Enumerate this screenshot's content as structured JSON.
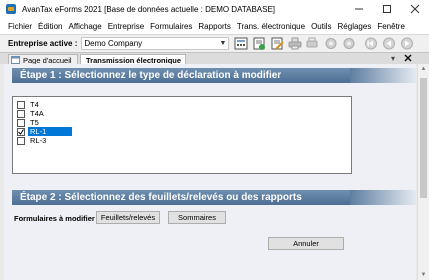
{
  "window": {
    "title": "AvanTax eForms 2021 [Base de données actuelle : DEMO DATABASE]"
  },
  "menu": [
    "Fichier",
    "Édition",
    "Affichage",
    "Entreprise",
    "Formulaires",
    "Rapports",
    "Trans. électronique",
    "Outils",
    "Réglages",
    "Fenêtre"
  ],
  "toolbar": {
    "company_label": "Entreprise active :",
    "company_value": "Demo Company"
  },
  "tabs": [
    {
      "label": "Page d'accueil",
      "active": false
    },
    {
      "label": "Transmission électronique",
      "active": true
    }
  ],
  "step1": {
    "title": "Étape 1 : Sélectionnez le type de déclaration à modifier"
  },
  "slips": [
    {
      "label": "T4",
      "checked": false,
      "selected": false
    },
    {
      "label": "T4A",
      "checked": false,
      "selected": false
    },
    {
      "label": "T5",
      "checked": false,
      "selected": false
    },
    {
      "label": "RL-1",
      "checked": true,
      "selected": true
    },
    {
      "label": "RL-3",
      "checked": false,
      "selected": false
    }
  ],
  "step2": {
    "title": "Étape 2 : Sélectionnez des feuillets/relevés ou des rapports"
  },
  "forms": {
    "label": "Formulaires à modifier",
    "slips_button": "Feuillets/relevés",
    "summaries_button": "Sommaires"
  },
  "cancel_button": "Annuler",
  "colors": {
    "header_blue": "#5b7ea2",
    "selection": "#0078d7"
  }
}
